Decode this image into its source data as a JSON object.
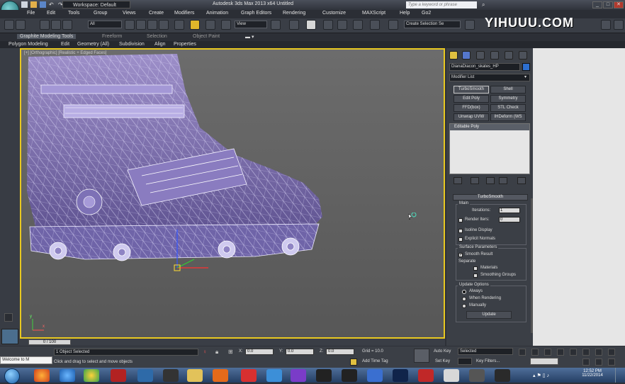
{
  "titlebar": {
    "workspace_label": "Workspace: Default",
    "title": "Autodesk 3ds Max  2013 x64     Untitled",
    "search_placeholder": "Type a keyword or phrase",
    "window_controls": [
      "_",
      "□",
      "✕"
    ]
  },
  "menu": [
    "File",
    "Edit",
    "Tools",
    "Group",
    "Views",
    "Create",
    "Modifiers",
    "Animation",
    "Graph Editors",
    "Rendering",
    "Customize",
    "MAXScript",
    "Help",
    "Go2"
  ],
  "toolbar": {
    "selection_filter": "All",
    "reference_coord": "View",
    "selection_set_placeholder": "Create Selection Se"
  },
  "watermark": "YIHUUU.COM",
  "ribbon": {
    "tabs": [
      "Graphite Modeling Tools",
      "Freeform",
      "Selection",
      "Object Paint"
    ],
    "sub": [
      "Polygon Modeling",
      "Edit",
      "Geometry (All)",
      "Subdivision",
      "Align",
      "Properties"
    ]
  },
  "viewport": {
    "label": "[+] [Orthographic] [Realistic + Edged Faces]",
    "axis_x": "x",
    "axis_y": "y"
  },
  "command_panel": {
    "object_name": "DianaDiacon_skates_HP",
    "object_color": "#2d6fd0",
    "modifier_list": "Modifier List",
    "modifier_buttons": [
      [
        "TurboSmooth",
        "Shell"
      ],
      [
        "Edit Poly",
        "Symmetry"
      ],
      [
        "FFD(box)",
        "STL Check"
      ],
      [
        "Unwrap UVW",
        "IHDeform (WS"
      ]
    ],
    "stack_item": "Editable Poly",
    "rollout_title": "TurboSmooth",
    "main_group": "Main",
    "iterations_label": "Iterations:",
    "iterations_value": "1",
    "render_iters_label": "Render Iters:",
    "render_iters_value": "0",
    "isoline_label": "Isoline Display",
    "explicit_normals_label": "Explicit Normals",
    "surface_group": "Surface Parameters",
    "smooth_result_label": "Smooth Result",
    "separate_label": "Separate",
    "materials_label": "Materials",
    "smoothing_groups_label": "Smoothing Groups",
    "update_group": "Update Options",
    "always_label": "Always",
    "when_rendering_label": "When Rendering",
    "manually_label": "Manually",
    "update_button": "Update"
  },
  "timeline": {
    "frame": "0 / 100"
  },
  "status": {
    "welcome": "Welcome to M",
    "selection": "1 Object Selected",
    "prompt": "Click and drag to select and move objects",
    "x_label": "X:",
    "x_value": "0.0",
    "y_label": "Y:",
    "y_value": "0.0",
    "z_label": "Z:",
    "z_value": "0.0",
    "grid": "Grid = 10.0",
    "add_time_tag": "Add Time Tag",
    "auto_key": "Auto Key",
    "set_key": "Set Key",
    "key_mode": "Selected",
    "key_filters": "Key Filters..."
  },
  "taskbar": {
    "time": "12:52 PM",
    "date": "11/22/2014"
  }
}
